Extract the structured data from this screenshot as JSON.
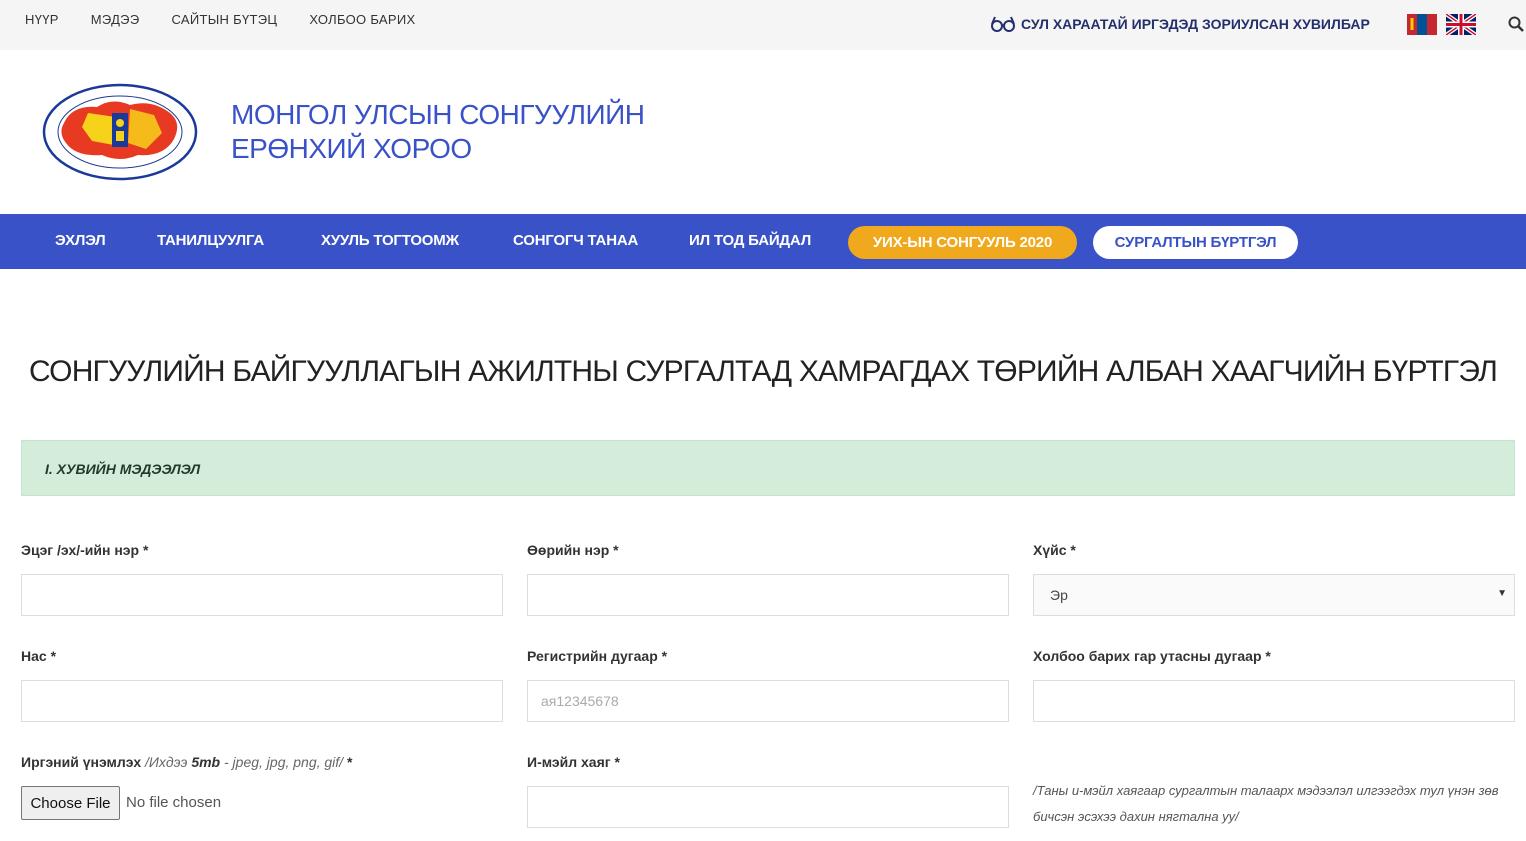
{
  "topbar": {
    "links": [
      "НҮҮР",
      "МЭДЭЭ",
      "САЙТЫН БҮТЭЦ",
      "ХОЛБОО БАРИХ"
    ],
    "accessibility_label": "СУЛ ХАРААТАЙ ИРГЭДЭД ЗОРИУЛСАН ХУВИЛБАР",
    "accessibility_icon": "glasses-icon"
  },
  "header": {
    "title_line1": "МОНГОЛ УЛСЫН СОНГУУЛИЙН",
    "title_line2": "ЕРӨНХИЙ ХОРОО",
    "logo_icon": "election-commission-logo"
  },
  "nav": {
    "items": [
      "ЭХЛЭЛ",
      "ТАНИЛЦУУЛГА",
      "ХУУЛЬ ТОГТООМЖ",
      "СОНГОГЧ ТАНАА",
      "ИЛ ТОД БАЙДАЛ"
    ],
    "pill_orange": "УИХ-ЫН СОНГУУЛЬ 2020",
    "pill_white": "СУРГАЛТЫН БҮРТГЭЛ"
  },
  "page_title": "СОНГУУЛИЙН БАЙГУУЛЛАГЫН АЖИЛТНЫ СУРГАЛТАД ХАМРАГДАХ ТӨРИЙН АЛБАН ХААГЧИЙН БҮРТГЭЛ",
  "section": {
    "label": "I. ХУВИЙН МЭДЭЭЛЭЛ"
  },
  "form": {
    "father_name_label": "Эцэг /эх/-ийн нэр *",
    "own_name_label": "Өөрийн нэр *",
    "gender_label": "Хүйс *",
    "gender_value": "Эр",
    "age_label": "Нас *",
    "register_label": "Регистрийн дугаар *",
    "register_placeholder": "ая12345678",
    "phone_label": "Холбоо барих гар утасны дугаар *",
    "id_label": "Иргэний үнэмлэх",
    "id_hint_prefix": " /Ихдээ ",
    "id_hint_size": "5mb",
    "id_hint_suffix": " - jpeg, jpg, png, gif/",
    "id_required": " *",
    "file_button": "Choose File",
    "file_status": "No file chosen",
    "email_label": "И-мэйл хаяг *",
    "email_note": "/Таны и-мэйл хаягаар сургалтын талаарх мэдээлэл илгээгдэх тул үнэн зөв бичсэн эсэхээ дахин нягтална уу/"
  }
}
